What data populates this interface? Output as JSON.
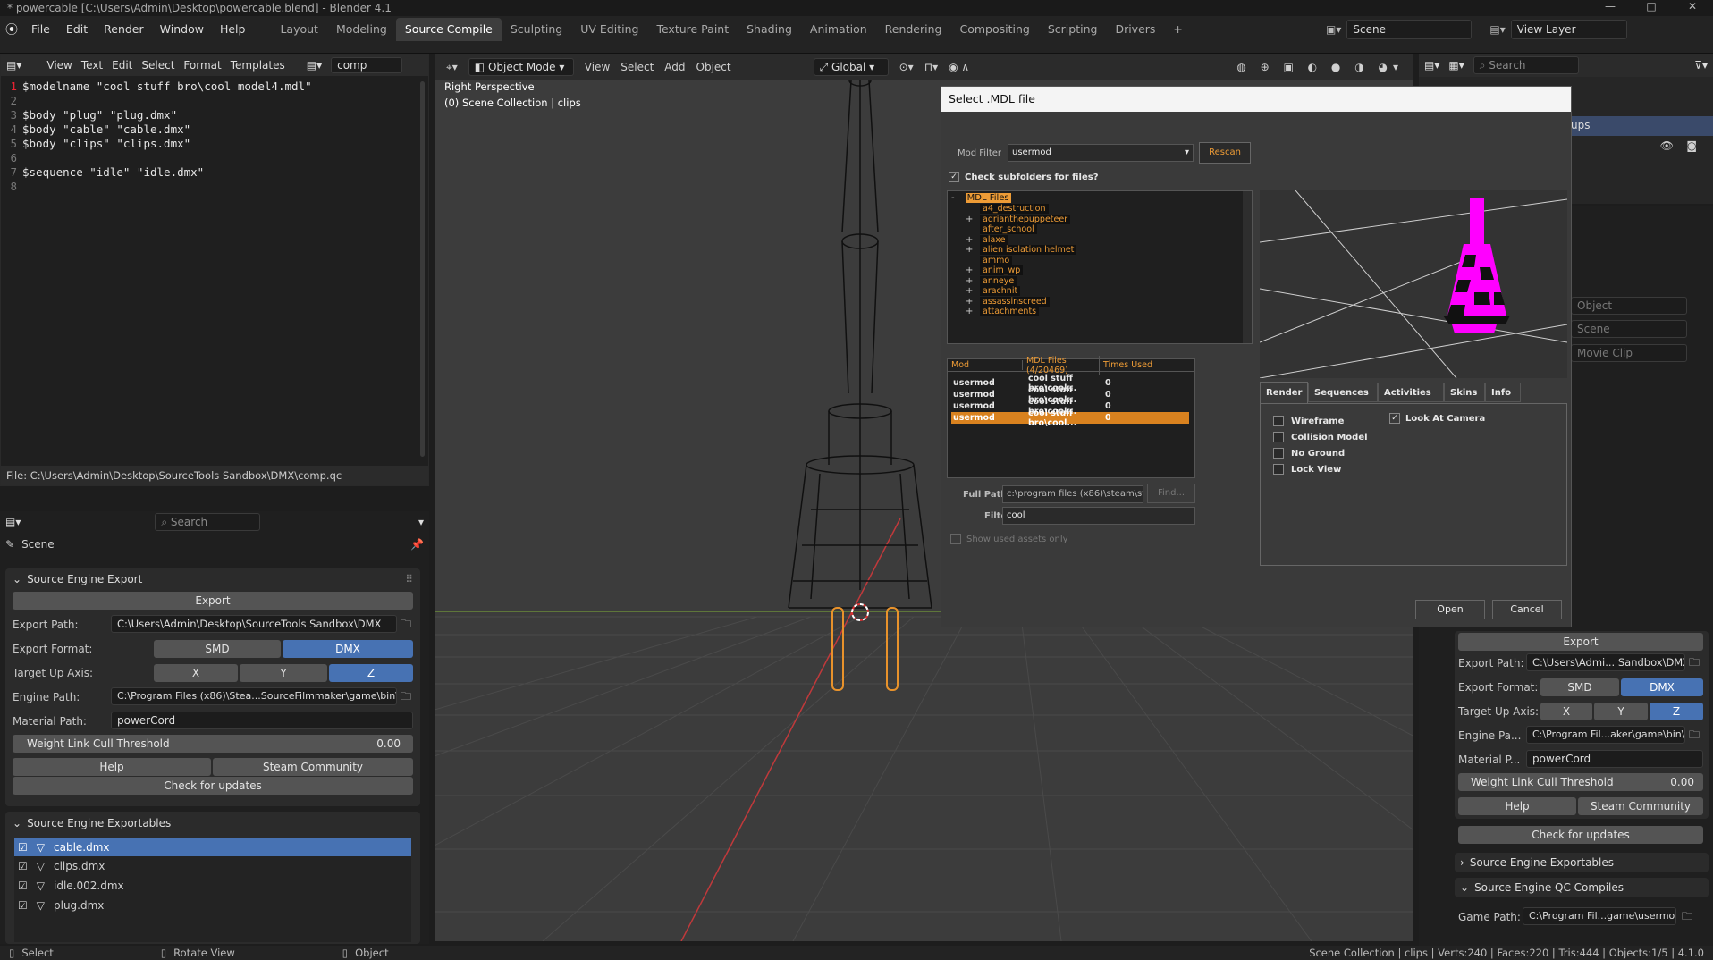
{
  "window": {
    "title": "* powercable [C:\\Users\\Admin\\Desktop\\powercable.blend] - Blender 4.1",
    "controls": [
      "—",
      "□",
      "✕"
    ]
  },
  "menu": [
    "File",
    "Edit",
    "Render",
    "Window",
    "Help"
  ],
  "workspaces": [
    "Layout",
    "Modeling",
    "Source Compile",
    "Sculpting",
    "UV Editing",
    "Texture Paint",
    "Shading",
    "Animation",
    "Rendering",
    "Compositing",
    "Scripting",
    "Drivers"
  ],
  "active_workspace": "Source Compile",
  "scene_field": "Scene",
  "view_layer_field": "View Layer",
  "text_editor": {
    "menu": [
      "View",
      "Text",
      "Edit",
      "Select",
      "Format",
      "Templates"
    ],
    "file_name": "comp",
    "lines": [
      {
        "n": "1",
        "text": "$modelname \"cool stuff bro\\cool model4.mdl\""
      },
      {
        "n": "2",
        "text": ""
      },
      {
        "n": "3",
        "text": "$body \"plug\" \"plug.dmx\""
      },
      {
        "n": "4",
        "text": "$body \"cable\" \"cable.dmx\""
      },
      {
        "n": "5",
        "text": "$body \"clips\" \"clips.dmx\""
      },
      {
        "n": "6",
        "text": ""
      },
      {
        "n": "7",
        "text": "$sequence \"idle\" \"idle.dmx\""
      },
      {
        "n": "8",
        "text": ""
      }
    ],
    "footer": "File: C:\\Users\\Admin\\Desktop\\SourceTools Sandbox\\DMX\\comp.qc"
  },
  "props_left": {
    "search_placeholder": "Search",
    "scene": "Scene",
    "export_section": "Source Engine Export",
    "export_button": "Export",
    "export_path_label": "Export Path:",
    "export_path": "C:\\Users\\Admin\\Desktop\\SourceTools Sandbox\\DMX",
    "export_format_label": "Export Format:",
    "formats": [
      "SMD",
      "DMX"
    ],
    "selected_format": "DMX",
    "up_axis_label": "Target Up Axis:",
    "axes": [
      "X",
      "Y",
      "Z"
    ],
    "selected_axis": "Z",
    "engine_path_label": "Engine Path:",
    "engine_path": "C:\\Program Files (x86)\\Stea...SourceFilmmaker\\game\\bin\\",
    "material_path_label": "Material Path:",
    "material_path": "powerCord",
    "weight_cull_label": "Weight Link Cull Threshold",
    "weight_cull_value": "0.00",
    "help": "Help",
    "steam_community": "Steam Community",
    "check_updates": "Check for updates",
    "exportables_section": "Source Engine Exportables",
    "exportables": [
      "cable.dmx",
      "clips.dmx",
      "idle.002.dmx",
      "plug.dmx"
    ]
  },
  "viewport": {
    "mode": "Object Mode",
    "menu": [
      "View",
      "Select",
      "Add",
      "Object"
    ],
    "transform": "Global",
    "perspective": "Right Perspective",
    "collection": "(0) Scene Collection | clips"
  },
  "dialog": {
    "title": "Select .MDL file",
    "mod_filter_label": "Mod Filter",
    "mod_filter": "usermod",
    "rescan": "Rescan",
    "check_subfolders": "Check subfolders for files?",
    "tree_root": "MDL Files",
    "tree": [
      "a4_destruction",
      "adrianthepuppeteer",
      "after_school",
      "alaxe",
      "alien isolation helmet",
      "ammo",
      "anim_wp",
      "anneye",
      "arachnit",
      "assassinscreed",
      "attachments"
    ],
    "tree_expandable": [
      false,
      true,
      false,
      true,
      true,
      false,
      true,
      true,
      true,
      true,
      true
    ],
    "columns": [
      "Mod",
      "MDL Files (4/20469)",
      "Times Used"
    ],
    "rows": [
      {
        "mod": "usermod",
        "file": "cool stuff bro\\cool...",
        "used": "0"
      },
      {
        "mod": "usermod",
        "file": "cool stuff bro\\cool...",
        "used": "0"
      },
      {
        "mod": "usermod",
        "file": "cool stuff bro\\cool...",
        "used": "0"
      },
      {
        "mod": "usermod",
        "file": "cool stuff bro\\cool...",
        "used": "0"
      }
    ],
    "selected_row": 3,
    "full_path_label": "Full Path",
    "full_path": "c:\\program files (x86)\\steam\\steama",
    "find": "Find...",
    "filter_label": "Filter",
    "filter": "cool",
    "show_used": "Show used assets only",
    "tabs": [
      "Render",
      "Sequences",
      "Activities",
      "Skins",
      "Info"
    ],
    "render_options": [
      {
        "label": "Wireframe",
        "checked": false
      },
      {
        "label": "Collision Model",
        "checked": false
      },
      {
        "label": "No Ground",
        "checked": false
      },
      {
        "label": "Lock View",
        "checked": false
      }
    ],
    "look_at_camera": "Look At Camera",
    "open": "Open",
    "cancel": "Cancel"
  },
  "outliner": {
    "search_placeholder": "Search",
    "item_partial": "ups"
  },
  "props_right": {
    "object_placeholder": "Object",
    "scene_placeholder": "Scene",
    "movie_clip_placeholder": "Movie Clip",
    "export_button": "Export",
    "export_path_label": "Export Path:",
    "export_path": "C:\\Users\\Admi... Sandbox\\DMX",
    "export_format_label": "Export Format:",
    "formats": [
      "SMD",
      "DMX"
    ],
    "up_axis_label": "Target Up Axis:",
    "axes": [
      "X",
      "Y",
      "Z"
    ],
    "engine_path_label": "Engine Pa...",
    "engine_path": "C:\\Program Fil...aker\\game\\bin\\",
    "material_path_label": "Material P...",
    "material_path": "powerCord",
    "weight_cull_label": "Weight Link Cull Threshold",
    "weight_cull_value": "0.00",
    "help": "Help",
    "steam_community": "Steam Community",
    "check_updates": "Check for updates",
    "exportables_section": "Source Engine Exportables",
    "qc_section": "Source Engine QC Compiles",
    "game_path_label": "Game Path:",
    "game_path": "C:\\Program Fil...game\\usermod"
  },
  "status": {
    "select": "Select",
    "rotate": "Rotate View",
    "object": "Object",
    "stats": "Scene Collection | clips | Verts:240 | Faces:220 | Tris:444 | Objects:1/5 | 4.1.0"
  },
  "colors": {
    "accent": "#4772b3",
    "vgui_orange": "#ee9c36",
    "preview_magenta": "#ff00ff"
  }
}
